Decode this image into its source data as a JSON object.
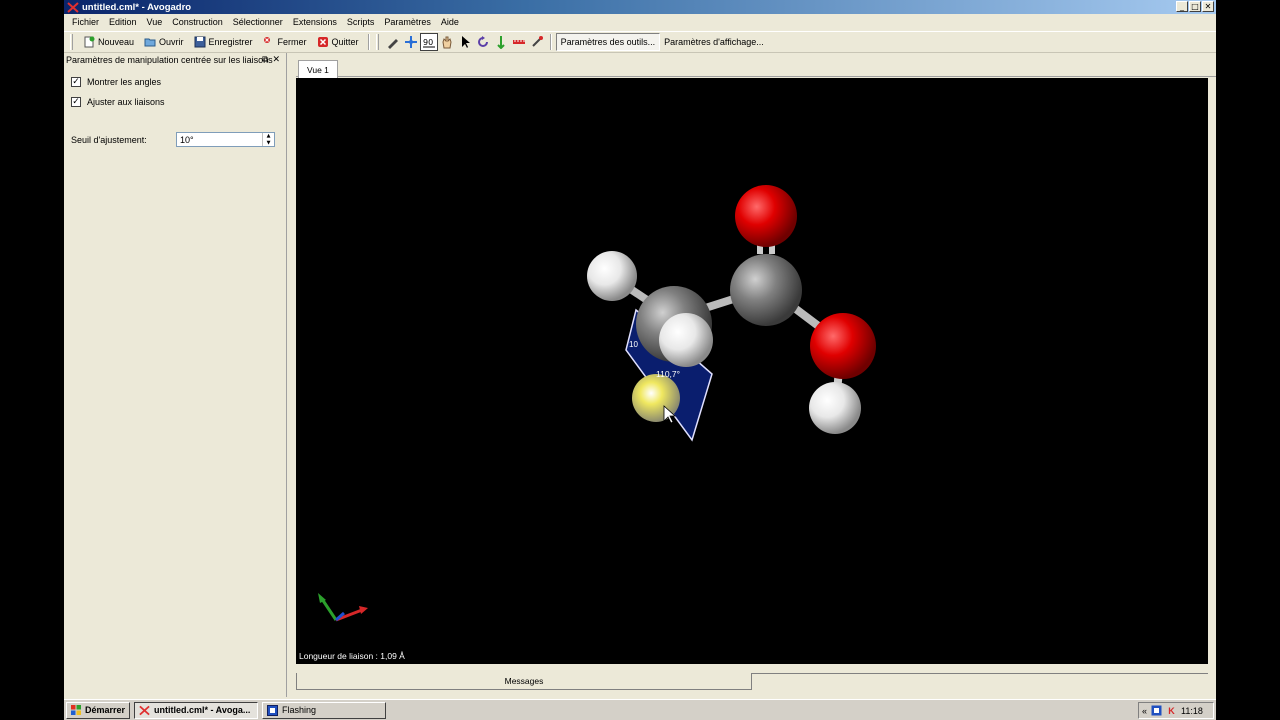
{
  "window": {
    "title": "untitled.cml* - Avogadro",
    "buttons": [
      "_",
      "□",
      "✕"
    ]
  },
  "menu": [
    "Fichier",
    "Edition",
    "Vue",
    "Construction",
    "Sélectionner",
    "Extensions",
    "Scripts",
    "Paramètres",
    "Aide"
  ],
  "toolbar": {
    "nouveau": "Nouveau",
    "ouvrir": "Ouvrir",
    "enregistrer": "Enregistrer",
    "fermer": "Fermer",
    "quitter": "Quitter",
    "tool_settings": "Paramètres des outils...",
    "display_settings": "Paramètres d'affichage..."
  },
  "dock": {
    "title": "Paramètres de manipulation centrée sur les liaisons",
    "show_angles": "Montrer les angles",
    "show_angles_checked": true,
    "snap_to_bonds": "Ajuster aux liaisons",
    "snap_to_bonds_checked": true,
    "snap_threshold_label": "Seuil d'ajustement:",
    "snap_threshold_value": "10°"
  },
  "view": {
    "tab": "Vue 1",
    "angle_label_1": "110,7°",
    "angle_label_2": "10",
    "status": "Longueur de liaison : 1,09 Å"
  },
  "messages": {
    "label": "Messages"
  },
  "taskbar": {
    "start": "Démarrer",
    "task1": "untitled.cml* - Avoga...",
    "task2": "Flashing",
    "clock": "11:18",
    "chevron": "«"
  },
  "colors": {
    "oxygen": "#e00000",
    "carbon": "#808080",
    "hydrogen": "#f0f0f0",
    "highlight": "#e8e050",
    "angle_plane": "#0a1e6e"
  }
}
